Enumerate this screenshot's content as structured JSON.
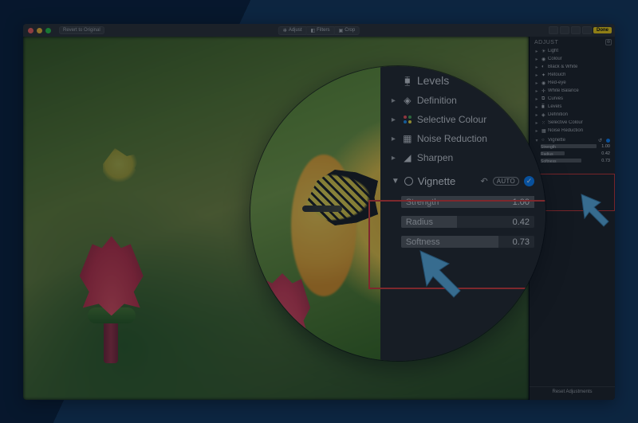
{
  "window": {
    "revert_label": "Revert to Original",
    "tabs": {
      "adjust": "Adjust",
      "filters": "Filters",
      "crop": "Crop"
    },
    "done": "Done"
  },
  "sidebar": {
    "title": "ADJUST",
    "items": [
      {
        "label": "Light"
      },
      {
        "label": "Colour"
      },
      {
        "label": "Black & White"
      },
      {
        "label": "Retouch"
      },
      {
        "label": "Red-eye"
      },
      {
        "label": "White Balance"
      },
      {
        "label": "Curves"
      },
      {
        "label": "Levels"
      },
      {
        "label": "Definition"
      },
      {
        "label": "Selective Colour"
      },
      {
        "label": "Noise Reduction"
      }
    ],
    "vignette": {
      "label": "Vignette",
      "strength": {
        "label": "Strength",
        "value": "1.00",
        "fill": 1.0
      },
      "radius": {
        "label": "Radius",
        "value": "0.42",
        "fill": 0.42
      },
      "softness": {
        "label": "Softness",
        "value": "0.73",
        "fill": 0.73
      }
    },
    "reset": "Reset Adjustments"
  },
  "zoom": {
    "rows": [
      {
        "label": "Levels"
      },
      {
        "label": "Definition"
      },
      {
        "label": "Selective Colour"
      },
      {
        "label": "Noise Reduction"
      },
      {
        "label": "Sharpen"
      }
    ],
    "vignette": {
      "label": "Vignette",
      "auto": "AUTO",
      "strength": {
        "label": "Strength",
        "value": "1.00",
        "fill": 1.0
      },
      "radius": {
        "label": "Radius",
        "value": "0.42",
        "fill": 0.42
      },
      "softness": {
        "label": "Softness",
        "value": "0.73",
        "fill": 0.73
      }
    }
  }
}
